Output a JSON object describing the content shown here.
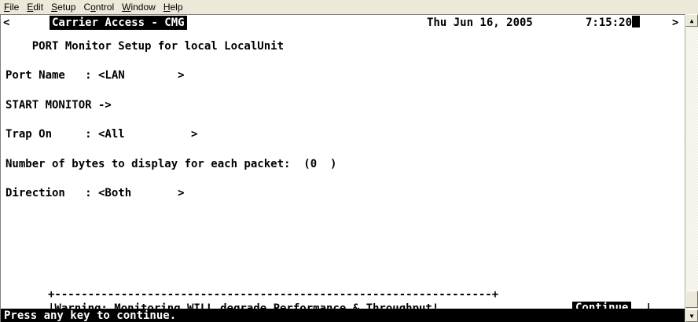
{
  "menubar": {
    "items": [
      {
        "pre": "",
        "key": "F",
        "post": "ile"
      },
      {
        "pre": "",
        "key": "E",
        "post": "dit"
      },
      {
        "pre": "",
        "key": "S",
        "post": "etup"
      },
      {
        "pre": "C",
        "key": "o",
        "post": "ntrol"
      },
      {
        "pre": "",
        "key": "W",
        "post": "indow"
      },
      {
        "pre": "",
        "key": "H",
        "post": "elp"
      }
    ]
  },
  "terminal": {
    "left_arrow": "<",
    "title": "Carrier Access - CMG",
    "date": "Thu Jun 16, 2005",
    "time": "7:15:20",
    "right_arrow": ">",
    "lines": [
      "    PORT Monitor Setup for local LocalUnit",
      "Port Name   : <LAN        >",
      "START MONITOR ->",
      "Trap On     : <All          >",
      "Number of bytes to display for each packet:  (0  )",
      "Direction   : <Both       >"
    ],
    "warning_border": "+------------------------------------------------------------------+",
    "warning_text": "|Warning: Monitoring WILL degrade Performance & Throughput!",
    "continue_label": "Continue",
    "warning_end": "|",
    "status_line": "Press any key to continue."
  },
  "scrollbar": {
    "up": "▲",
    "down": "▼"
  }
}
